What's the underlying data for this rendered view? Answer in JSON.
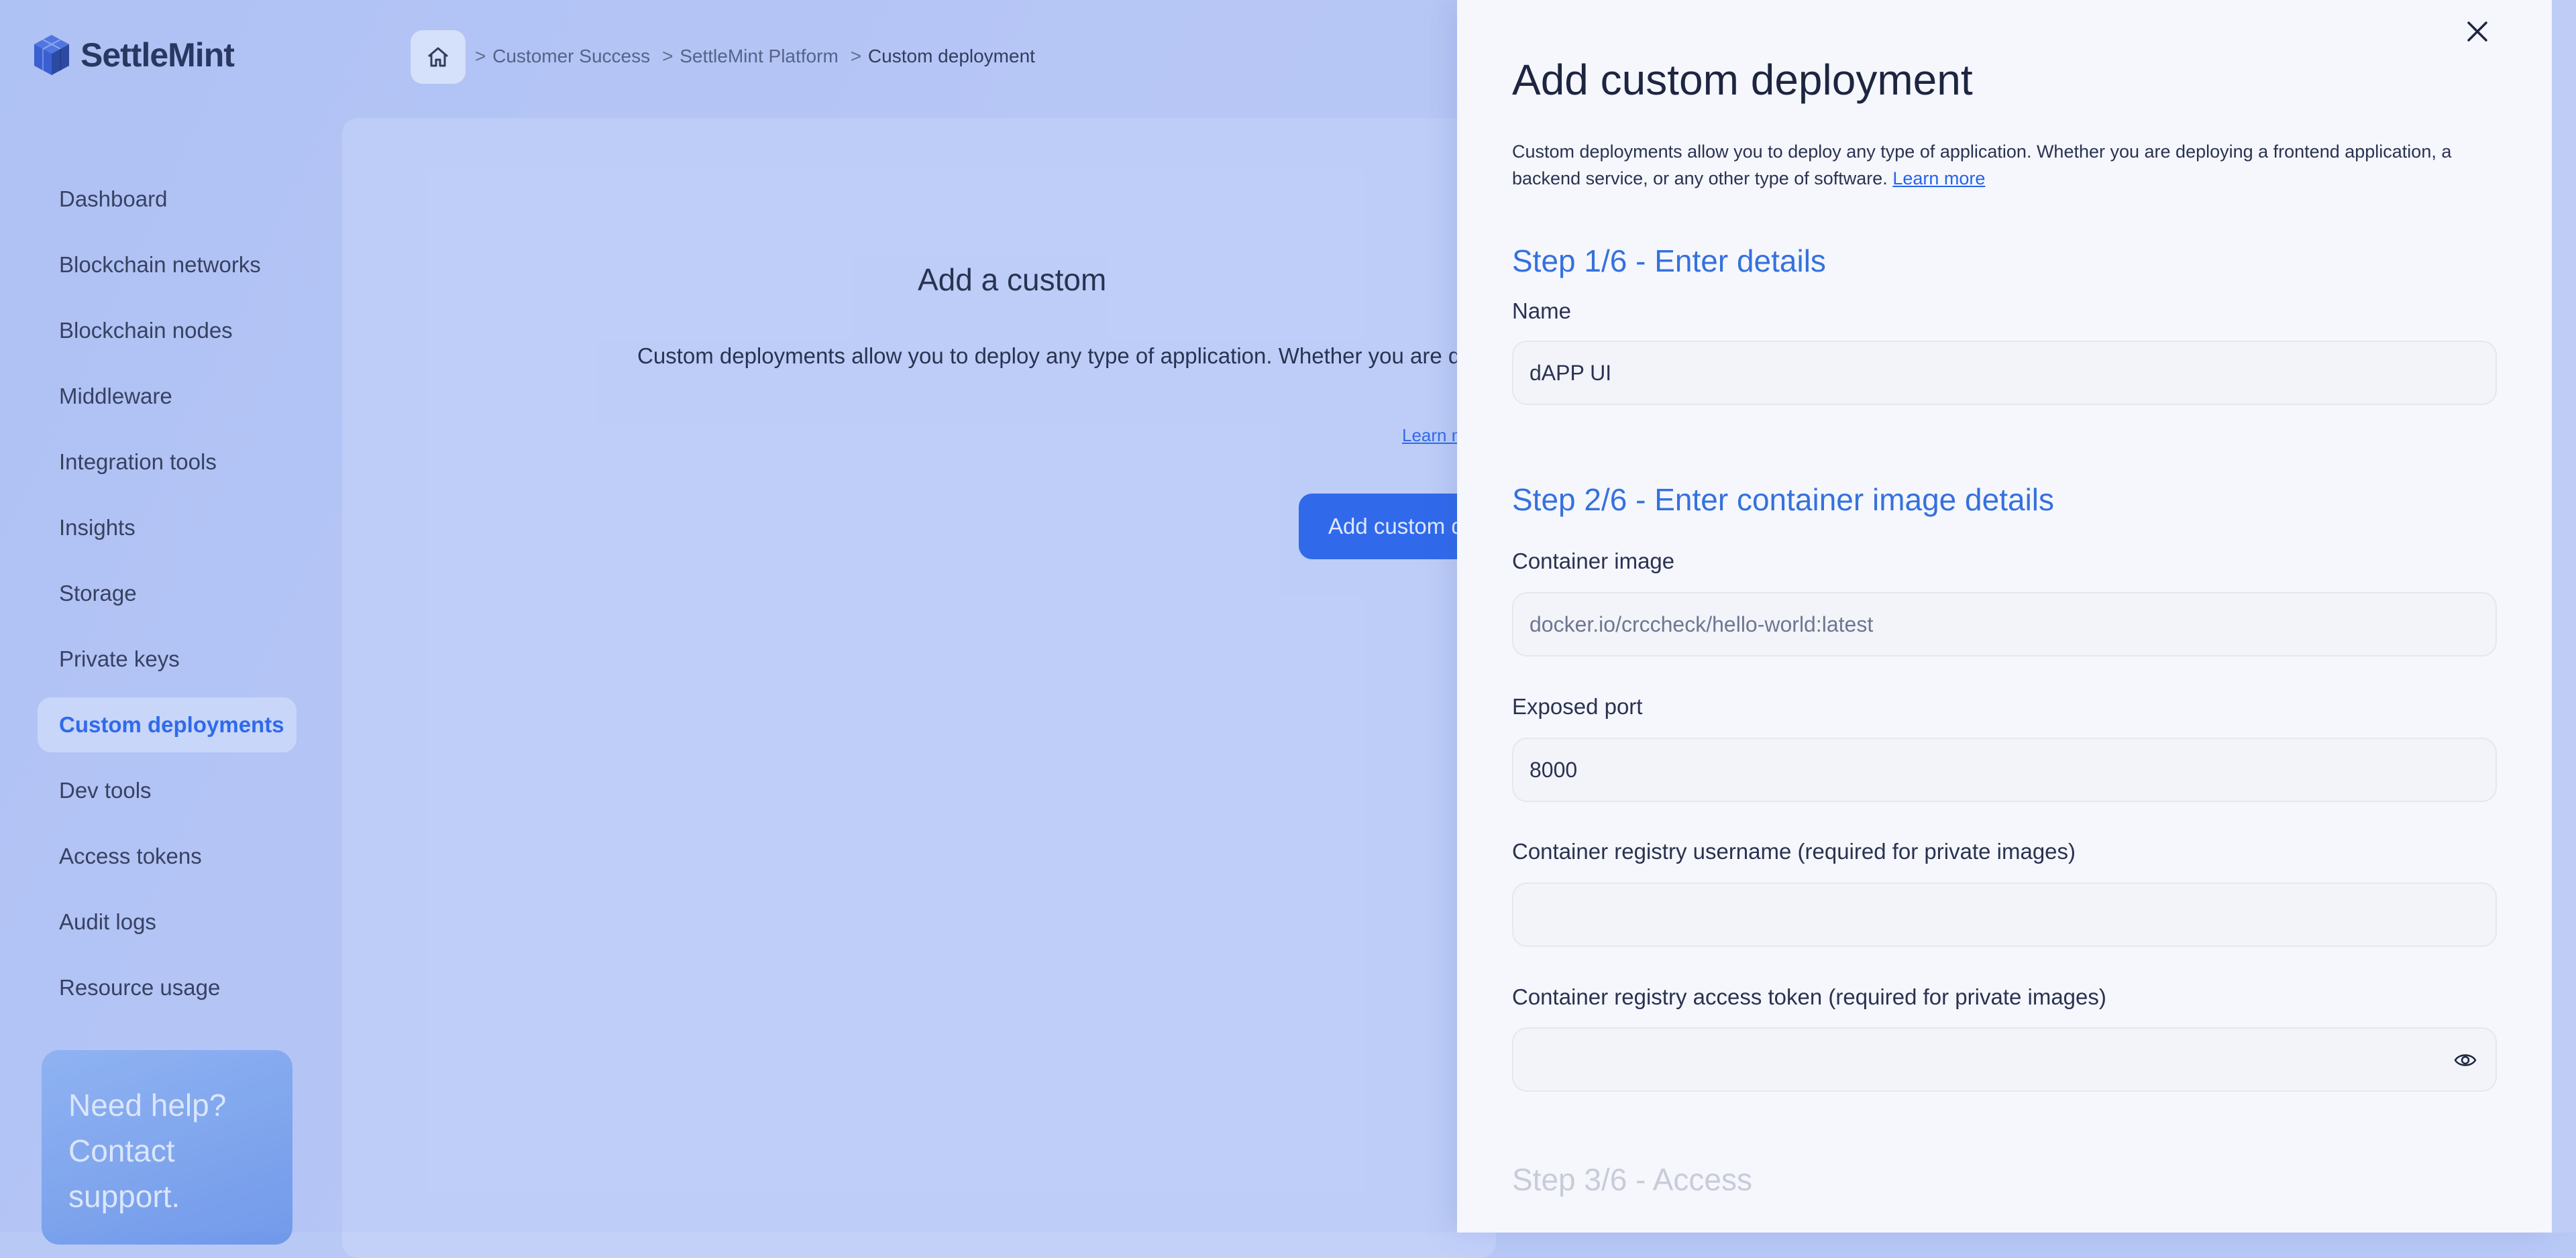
{
  "app": {
    "logo_text": "SettleMint"
  },
  "breadcrumb": {
    "items": [
      "Customer Success",
      "SettleMint Platform",
      "Custom deployment"
    ],
    "separator": ">"
  },
  "sidebar": {
    "items": [
      {
        "label": "Dashboard"
      },
      {
        "label": "Blockchain networks"
      },
      {
        "label": "Blockchain nodes"
      },
      {
        "label": "Middleware"
      },
      {
        "label": "Integration tools"
      },
      {
        "label": "Insights"
      },
      {
        "label": "Storage"
      },
      {
        "label": "Private keys"
      },
      {
        "label": "Custom deployments",
        "active": true
      },
      {
        "label": "Dev tools"
      },
      {
        "label": "Access tokens"
      },
      {
        "label": "Audit logs"
      },
      {
        "label": "Resource usage"
      }
    ],
    "help": {
      "line1": "Need help?",
      "line2": "Contact",
      "line3": "support."
    }
  },
  "main": {
    "title": "Add a custom",
    "description": "Custom deployments allow you to deploy any type of application. Whether you are d",
    "learn_more": "Learn m",
    "button": "Add custom d"
  },
  "drawer": {
    "title": "Add custom deployment",
    "description": "Custom deployments allow you to deploy any type of application. Whether you are deploying a frontend application, a backend service, or any other type of software.",
    "learn_more": "Learn more",
    "step1": {
      "title": "Step 1/6 - Enter details",
      "name_label": "Name",
      "name_value": "dAPP UI"
    },
    "step2": {
      "title": "Step 2/6 - Enter container image details",
      "image_label": "Container image",
      "image_value": "docker.io/crccheck/hello-world:latest",
      "port_label": "Exposed port",
      "port_value": "8000",
      "username_label": "Container registry username (required for private images)",
      "username_value": "",
      "token_label": "Container registry access token (required for private images)",
      "token_value": ""
    },
    "step3": {
      "title": "Step 3/6 - Access"
    }
  },
  "colors": {
    "accent": "#2563eb",
    "step_heading": "#3571dd",
    "background": "#b9c9f6"
  }
}
